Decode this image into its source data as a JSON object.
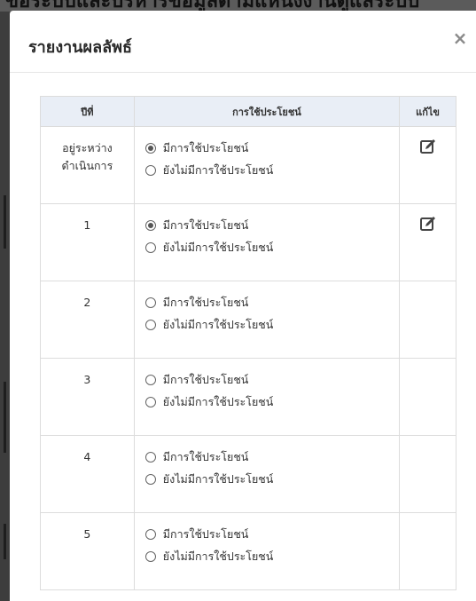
{
  "backdrop": {
    "title": "ข้อระบบและบริหารข้อมูลตามแหน่งงานดูแลระบบ"
  },
  "modal": {
    "title": "รายงานผลลัพธ์",
    "close_glyph": "×"
  },
  "table": {
    "headers": {
      "year": "ปีที่",
      "usage": "การใช้ประโยชน์",
      "edit": "แก้ไข"
    },
    "option_labels": {
      "used": "มีการใช้ประโยชน์",
      "not_used": "ยังไม่มีการใช้ประโยชน์"
    },
    "rows": [
      {
        "year_line1": "อยู่ระหว่าง",
        "year_line2": "ดำเนินการ",
        "used_selected": true,
        "editable": true
      },
      {
        "year_line1": "1",
        "year_line2": "",
        "used_selected": true,
        "editable": true
      },
      {
        "year_line1": "2",
        "year_line2": "",
        "used_selected": false,
        "editable": false
      },
      {
        "year_line1": "3",
        "year_line2": "",
        "used_selected": false,
        "editable": false
      },
      {
        "year_line1": "4",
        "year_line2": "",
        "used_selected": false,
        "editable": false
      },
      {
        "year_line1": "5",
        "year_line2": "",
        "used_selected": false,
        "editable": false
      }
    ]
  },
  "icons": {
    "edit": "edit-icon",
    "close": "close-icon"
  },
  "colors": {
    "header_bg": "#e9eef6",
    "border": "#dcdcdc",
    "overlay": "#4a4a4a",
    "icon": "#444444"
  }
}
